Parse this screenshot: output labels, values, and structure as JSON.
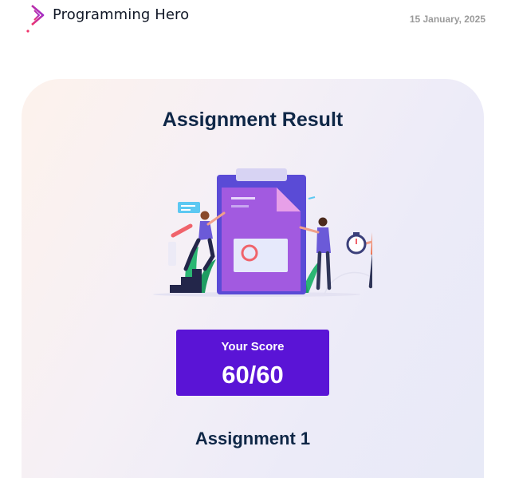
{
  "header": {
    "brand": "Programming Hero",
    "date": "15 January, 2025",
    "logo_icon": "programming-hero-logo-icon"
  },
  "card": {
    "title": "Assignment Result",
    "illustration": "clipboard-team-illustration",
    "score_label": "Your Score",
    "score_value": "60/60",
    "assignment_name": "Assignment 1"
  },
  "colors": {
    "brand_purple": "#5a14d6",
    "title_navy": "#0f2747",
    "logo_gradient": [
      "#f0336b",
      "#8a2be2"
    ]
  }
}
